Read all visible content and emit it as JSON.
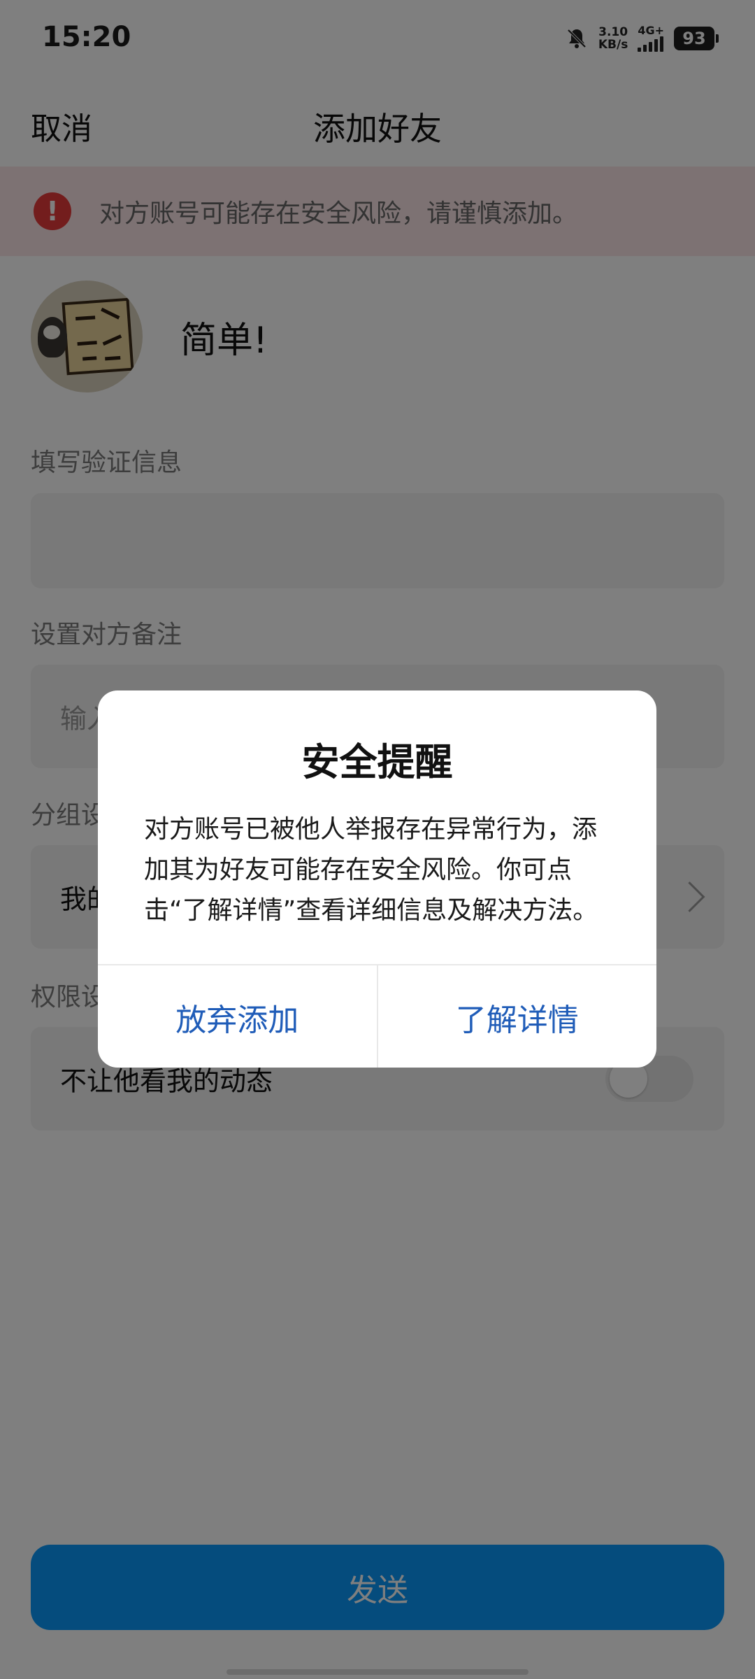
{
  "status_bar": {
    "time": "15:20",
    "speed_value": "3.10",
    "speed_unit": "KB/s",
    "network": "4G+",
    "battery": "93",
    "icons": [
      "bell-off-icon",
      "signal-icon",
      "battery-icon"
    ]
  },
  "header": {
    "cancel_label": "取消",
    "title": "添加好友"
  },
  "warning": {
    "icon": "exclamation-icon",
    "text": "对方账号可能存在安全风险，请谨慎添加。",
    "color": "#e63a3a"
  },
  "profile": {
    "nickname": "简单!"
  },
  "form": {
    "verify_label": "填写验证信息",
    "verify_value": "",
    "remark_label": "设置对方备注",
    "remark_placeholder": "输入备注",
    "group_label": "分组设置",
    "group_value": "我的好友",
    "permission_label": "权限设置",
    "permission_option": "不让他看我的动态",
    "permission_enabled": false
  },
  "send_button": {
    "label": "发送",
    "color": "#0a99fb"
  },
  "dialog": {
    "title": "安全提醒",
    "message": "对方账号已被他人举报存在异常行为，添加其为好友可能存在安全风险。你可点击“了解详情”查看详细信息及解决方法。",
    "abandon_label": "放弃添加",
    "details_label": "了解详情",
    "button_color": "#1f5cb8"
  }
}
